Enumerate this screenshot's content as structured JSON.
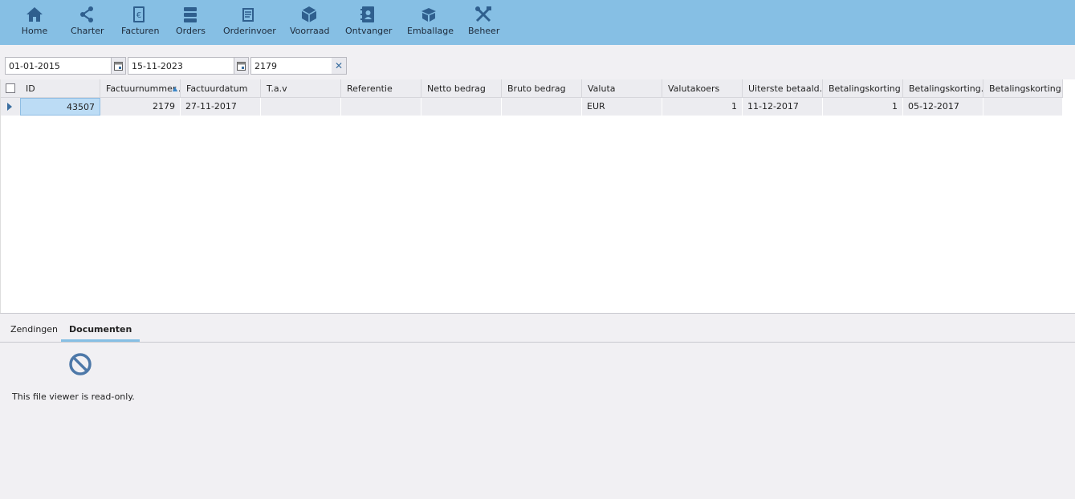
{
  "toolbar": {
    "items": [
      {
        "label": "Home",
        "icon": "home-icon"
      },
      {
        "label": "Charter",
        "icon": "share-icon"
      },
      {
        "label": "Facturen",
        "icon": "invoice-icon"
      },
      {
        "label": "Orders",
        "icon": "list-icon"
      },
      {
        "label": "Orderinvoer",
        "icon": "form-icon"
      },
      {
        "label": "Voorraad",
        "icon": "box-icon"
      },
      {
        "label": "Ontvanger",
        "icon": "address-book-icon"
      },
      {
        "label": "Emballage",
        "icon": "package-icon"
      },
      {
        "label": "Beheer",
        "icon": "tools-icon"
      }
    ]
  },
  "filters": {
    "date_from": "01-01-2015",
    "date_to": "15-11-2023",
    "search": "2179",
    "clear_symbol": "✕"
  },
  "grid": {
    "columns": [
      "ID",
      "Factuurnummer...",
      "Factuurdatum",
      "T.a.v",
      "Referentie",
      "Netto bedrag",
      "Bruto bedrag",
      "Valuta",
      "Valutakoers",
      "Uiterste betaald...",
      "Betalingskorting",
      "Betalingskorting...",
      "Betalingskorting..."
    ],
    "sorted_column": "Factuurnummer...",
    "sort_direction": "ascending",
    "rows": [
      {
        "id": "43507",
        "factuurnummer": "2179",
        "factuurdatum": "27-11-2017",
        "tav": "",
        "referentie": "",
        "netto": "",
        "bruto": "",
        "valuta": "EUR",
        "valutakoers": "1",
        "uiterste": "11-12-2017",
        "betalingskorting": "1",
        "betalingskorting_datum": "05-12-2017",
        "betalingskorting_3": ""
      }
    ]
  },
  "tabs": [
    {
      "label": "Zendingen",
      "active": false
    },
    {
      "label": "Documenten",
      "active": true
    }
  ],
  "viewer": {
    "icon": "no-entry-icon",
    "message": "This file viewer is read-only."
  },
  "colors": {
    "toolbar_bg": "#86bfe4",
    "icon_color": "#2f5f8e",
    "selected_cell": "#bcdcf5"
  }
}
